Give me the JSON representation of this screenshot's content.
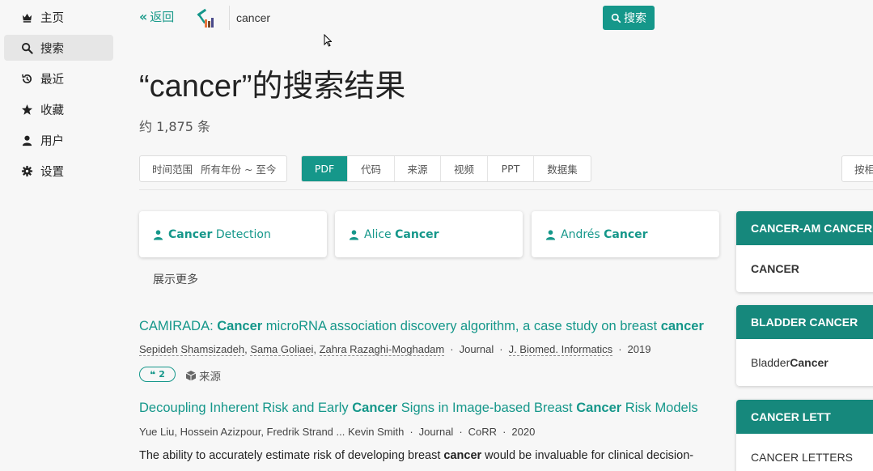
{
  "sidebar": {
    "items": [
      {
        "label": "主页",
        "icon": "crown-icon"
      },
      {
        "label": "搜索",
        "icon": "search-icon"
      },
      {
        "label": "最近",
        "icon": "history-icon"
      },
      {
        "label": "收藏",
        "icon": "star-icon"
      },
      {
        "label": "用户",
        "icon": "user-icon"
      },
      {
        "label": "设置",
        "icon": "gear-icon"
      }
    ],
    "active": "搜索"
  },
  "topbar": {
    "back_label": "返回",
    "search_value": "cancer",
    "search_button": "搜索"
  },
  "header": {
    "title": "“cancer”的搜索结果",
    "count": "约 1,875 条"
  },
  "filters": {
    "time_label": "时间范围",
    "time_value": "所有年份 ~ 至今",
    "tabs": [
      "PDF",
      "代码",
      "来源",
      "视频",
      "PPT",
      "数据集"
    ],
    "active_tab": "PDF",
    "sort_label": "按相"
  },
  "authors": {
    "cards": [
      {
        "plain": "",
        "bold": "Cancer",
        "rest": " Detection"
      },
      {
        "plain": "Alice ",
        "bold": "Cancer",
        "rest": ""
      },
      {
        "plain": "Andrés ",
        "bold": "Cancer",
        "rest": ""
      }
    ],
    "show_more": "展示更多"
  },
  "results": [
    {
      "title_parts": [
        {
          "t": "CAMIRADA: ",
          "b": false
        },
        {
          "t": "Cancer",
          "b": true
        },
        {
          "t": " microRNA association discovery algorithm, a case study on breast ",
          "b": false
        },
        {
          "t": "cancer",
          "b": true
        }
      ],
      "authors": [
        "Sepideh Shamsizadeh",
        "Sama Goliaei",
        "Zahra Razaghi-Moghadam"
      ],
      "type": "Journal",
      "venue": "J. Biomed. Informatics",
      "year": "2019",
      "citations": "2",
      "source_label": "来源"
    },
    {
      "title_parts": [
        {
          "t": "Decoupling Inherent Risk and Early ",
          "b": false
        },
        {
          "t": "Cancer",
          "b": true
        },
        {
          "t": " Signs in Image-based Breast ",
          "b": false
        },
        {
          "t": "Cancer",
          "b": true
        },
        {
          "t": " Risk Models",
          "b": false
        }
      ],
      "authors_text": "Yue Liu, Hossein Azizpour, Fredrik Strand ... Kevin Smith",
      "type": "Journal",
      "venue": "CoRR",
      "year": "2020",
      "abstract_parts": [
        {
          "t": "The ability to accurately estimate risk of developing breast ",
          "b": false
        },
        {
          "t": "cancer",
          "b": true
        },
        {
          "t": " would be invaluable for clinical decision-",
          "b": false
        }
      ]
    }
  ],
  "side_cards": [
    {
      "header": "CANCER-AM CANCER",
      "body_bold": "CANCER",
      "body_plain": ""
    },
    {
      "header": "BLADDER CANCER",
      "body_plain": "Bladder ",
      "body_bold": "Cancer"
    },
    {
      "header": "CANCER LETT",
      "body_plain": "CANCER LETTERS",
      "body_bold": ""
    }
  ],
  "colors": {
    "accent": "#15978a",
    "accent_dark": "#16887c"
  }
}
